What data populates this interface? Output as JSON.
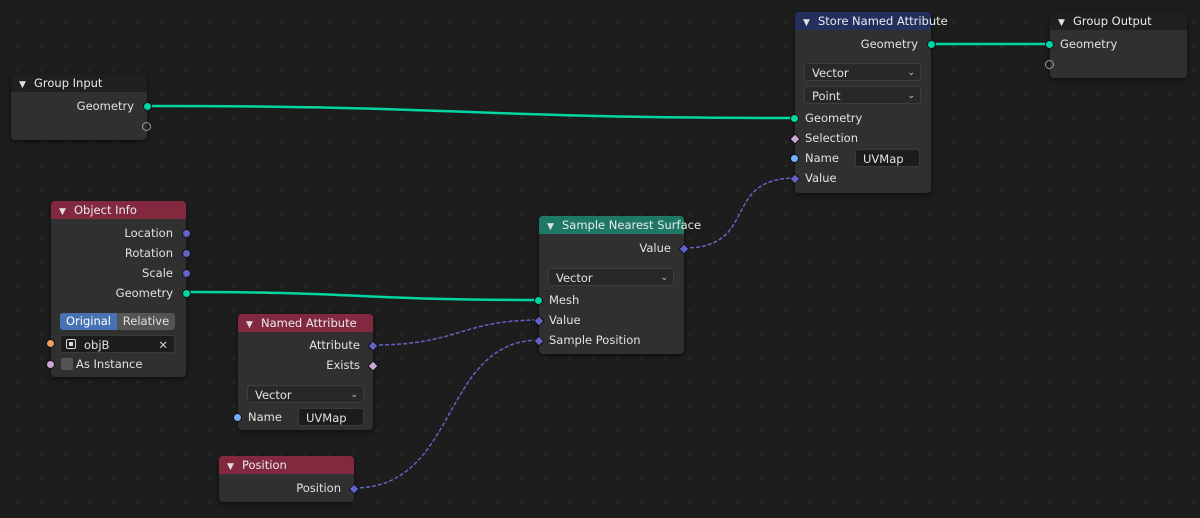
{
  "nodes": {
    "group_input": {
      "title": "Group Input",
      "outputs": [
        "Geometry"
      ]
    },
    "object_info": {
      "title": "Object Info",
      "outputs": [
        "Location",
        "Rotation",
        "Scale",
        "Geometry"
      ],
      "transform_space": {
        "options": [
          "Original",
          "Relative"
        ],
        "selected": "Original"
      },
      "object": {
        "value": "objB",
        "clear": "✕"
      },
      "as_instance_label": "As Instance"
    },
    "named_attribute": {
      "title": "Named Attribute",
      "outputs": [
        "Attribute",
        "Exists"
      ],
      "data_type": "Vector",
      "name_label": "Name",
      "name_value": "UVMap"
    },
    "position": {
      "title": "Position",
      "outputs": [
        "Position"
      ]
    },
    "sample_nearest_surface": {
      "title": "Sample Nearest Surface",
      "outputs": [
        "Value"
      ],
      "data_type": "Vector",
      "inputs": [
        "Mesh",
        "Value",
        "Sample Position"
      ]
    },
    "store_named_attribute": {
      "title": "Store Named Attribute",
      "outputs": [
        "Geometry"
      ],
      "data_type": "Vector",
      "domain": "Point",
      "inputs": [
        "Geometry",
        "Selection",
        "Name",
        "Value"
      ],
      "name_value": "UVMap"
    },
    "group_output": {
      "title": "Group Output",
      "inputs": [
        "Geometry"
      ]
    }
  },
  "colors": {
    "geometry_socket": "#00d6a3",
    "vector_socket": "#6363c7",
    "string_socket": "#70b2ff",
    "object_socket": "#ed9e5c",
    "boolean_socket": "#cca6d6",
    "input_header": "#82293f",
    "geometry_header": "#1f7866",
    "attribute_header": "#23305e"
  }
}
